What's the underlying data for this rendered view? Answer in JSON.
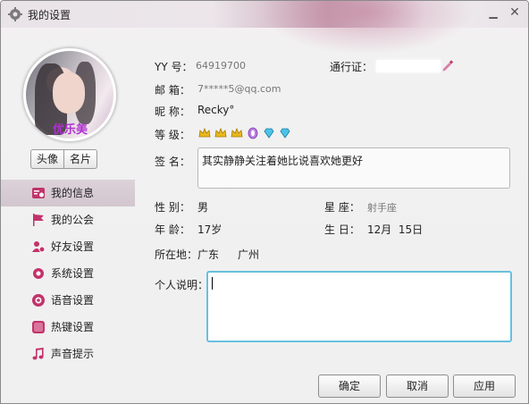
{
  "window": {
    "title": "我的设置"
  },
  "avatar": {
    "caption": "优乐美"
  },
  "avatar_buttons": {
    "avatar_label": "头像",
    "card_label": "名片"
  },
  "sidebar": {
    "items": [
      {
        "label": "我的信息",
        "icon": "profile-card-icon",
        "color": "#c2336b",
        "active": true
      },
      {
        "label": "我的公会",
        "icon": "flag-icon",
        "color": "#c2336b",
        "active": false
      },
      {
        "label": "好友设置",
        "icon": "friends-gear-icon",
        "color": "#c2336b",
        "active": false
      },
      {
        "label": "系统设置",
        "icon": "gear-icon",
        "color": "#c2336b",
        "active": false
      },
      {
        "label": "语音设置",
        "icon": "speaker-icon",
        "color": "#c2336b",
        "active": false
      },
      {
        "label": "热键设置",
        "icon": "keyboard-icon",
        "color": "#c2336b",
        "active": false
      },
      {
        "label": "声音提示",
        "icon": "music-note-icon",
        "color": "#c2336b",
        "active": false
      }
    ]
  },
  "profile": {
    "yy_label": "YY 号：",
    "yy_value": "64919700",
    "passport_label": "通行证：",
    "email_label": "邮  箱：",
    "email_value": "7*****5@qq.com",
    "nickname_label": "昵  称：",
    "nickname_value": "Recky°",
    "level_label": "等  级：",
    "level_icons": [
      "crown-icon",
      "crown-icon",
      "crown-icon",
      "moon-icon",
      "diamond-icon",
      "diamond-icon"
    ],
    "signature_label": "签  名：",
    "signature_value": "其实静静关注着她比说喜欢她更好",
    "gender_label": "性  别：",
    "gender_value": "男",
    "zodiac_label": "星  座：",
    "zodiac_value": "射手座",
    "age_label": "年  龄：",
    "age_value": "17岁",
    "birthday_label": "生  日：",
    "birthday_value": "12月  15日",
    "location_label": "所在地：",
    "location_province": "广东",
    "location_city": "广州",
    "description_label": "个人说明：",
    "description_value": ""
  },
  "buttons": {
    "ok": "确定",
    "cancel": "取消",
    "apply": "应用"
  },
  "colors": {
    "accent": "#68c0df",
    "sidebar_active": "#d6cad1",
    "nav_icon": "#c2336b"
  }
}
